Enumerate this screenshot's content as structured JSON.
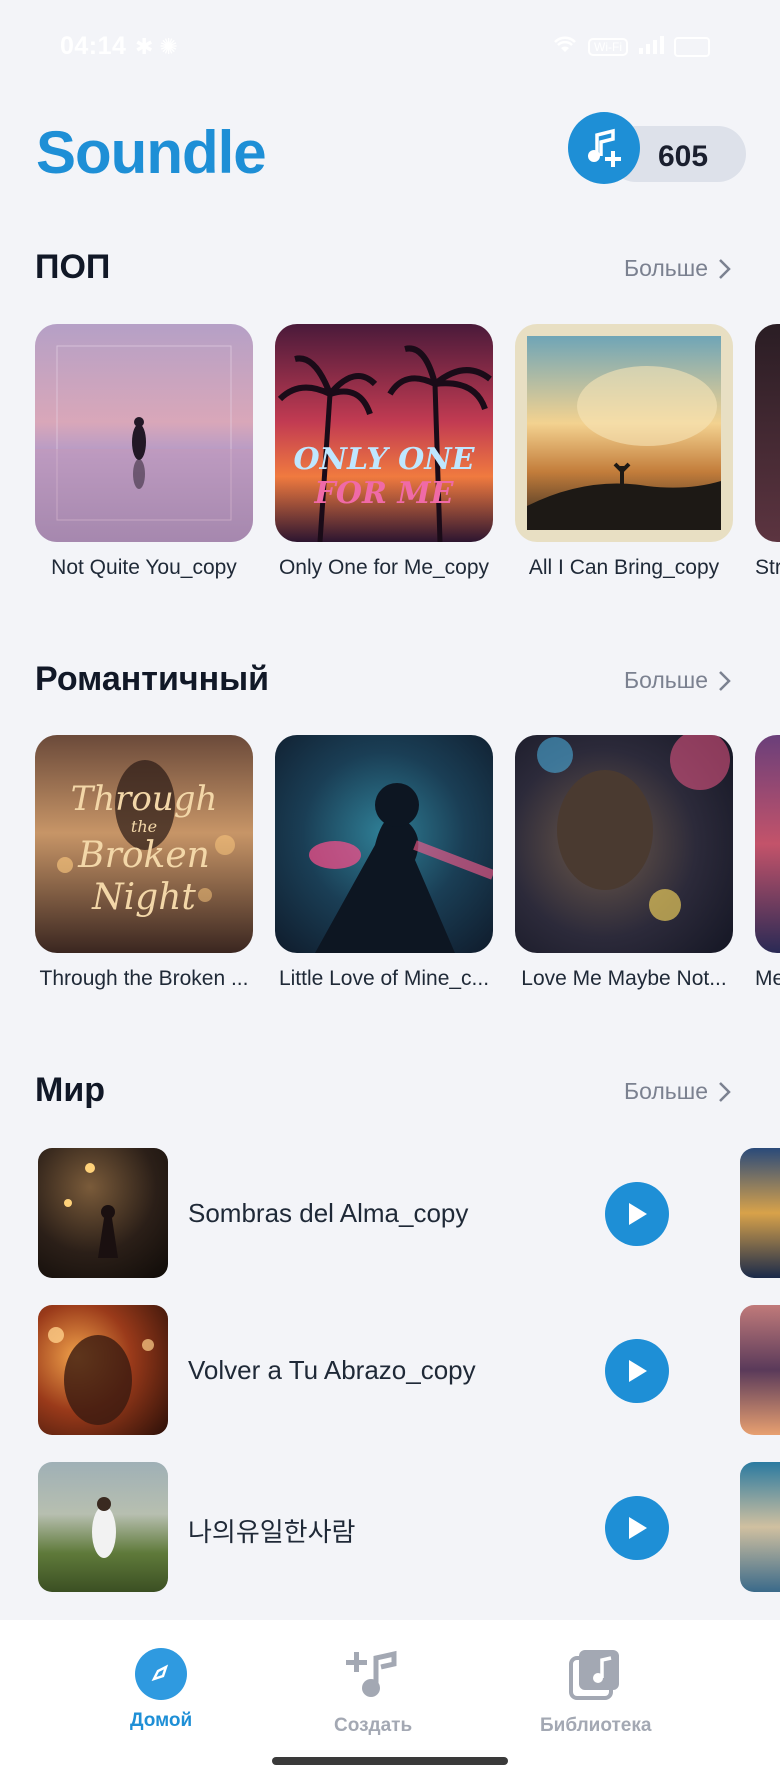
{
  "status_bar": {
    "time": "04:14",
    "left_icons": "✱ ✺",
    "net_badge": "Wi-Fi"
  },
  "header": {
    "logo": "Soundle",
    "credits": "605"
  },
  "sections": {
    "pop": {
      "title": "ПОП",
      "more": "Больше",
      "items": [
        {
          "title": "Not Quite You_copy"
        },
        {
          "title": "Only One for Me_copy",
          "cover_text_1": "ONLY ONE",
          "cover_text_2": "FOR ME"
        },
        {
          "title": "All I Can Bring_copy"
        },
        {
          "title": "Str"
        }
      ]
    },
    "romantic": {
      "title": "Романтичный",
      "more": "Больше",
      "items": [
        {
          "title": "Through the Broken ...",
          "cover_text_1": "Through",
          "cover_text_2": "the",
          "cover_text_3": "Broken",
          "cover_text_4": "Night"
        },
        {
          "title": "Little Love of Mine_c..."
        },
        {
          "title": "Love Me Maybe Not..."
        },
        {
          "title": "Me"
        }
      ]
    },
    "world": {
      "title": "Мир",
      "more": "Больше",
      "items": [
        {
          "title": "Sombras del Alma_copy"
        },
        {
          "title": "Volver a Tu Abrazo_copy"
        },
        {
          "title": "나의유일한사람"
        }
      ]
    }
  },
  "nav": {
    "home": "Домой",
    "create": "Создать",
    "library": "Библиотека"
  },
  "colors": {
    "accent": "#1e8fd6",
    "inactive": "#a3a8b3",
    "background": "#f3f4f8"
  }
}
